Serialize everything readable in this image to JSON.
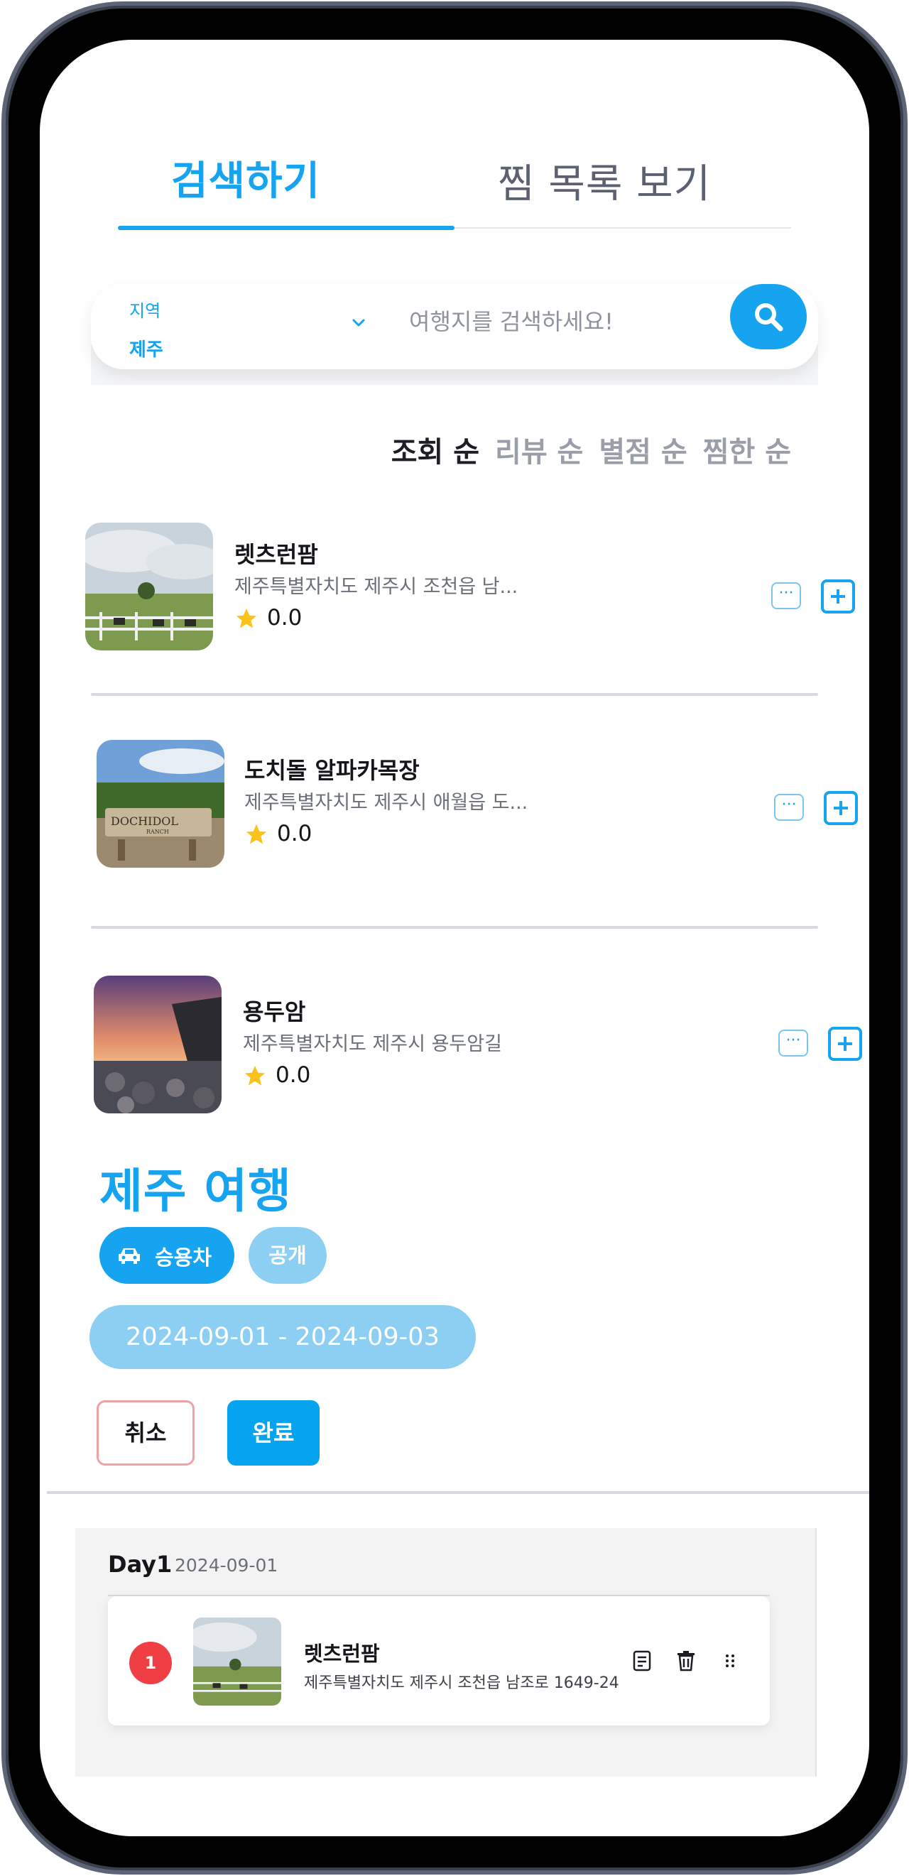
{
  "tabs": {
    "search": "검색하기",
    "saved": "찜 목록 보기"
  },
  "search": {
    "region_label": "지역",
    "region_value": "제주",
    "placeholder": "여행지를 검색하세요!"
  },
  "sort": [
    "조회 순",
    "리뷰 순",
    "별점 순",
    "찜한 순"
  ],
  "results": [
    {
      "title": "렛츠런팜",
      "address": "제주특별자치도 제주시 조천읍 남...",
      "rating": "0.0"
    },
    {
      "title": "도치돌 알파카목장",
      "address": "제주특별자치도 제주시 애월읍 도...",
      "rating": "0.0"
    },
    {
      "title": "용두암",
      "address": "제주특별자치도 제주시 용두암길",
      "rating": "0.0"
    }
  ],
  "trip": {
    "title": "제주 여행",
    "vehicle": "승용차",
    "visibility": "공개",
    "dates": "2024-09-01 - 2024-09-03",
    "cancel": "취소",
    "done": "완료"
  },
  "itinerary": {
    "day_title": "Day1",
    "day_date": "2024-09-01",
    "stop_number": "1",
    "stop_title": "렛츠런팜",
    "stop_address": "제주특별자치도 제주시 조천읍 남조로 1649-24"
  },
  "colors": {
    "accent": "#16a3f0",
    "accent_light": "#8ccff3",
    "danger": "#ef3f44"
  }
}
